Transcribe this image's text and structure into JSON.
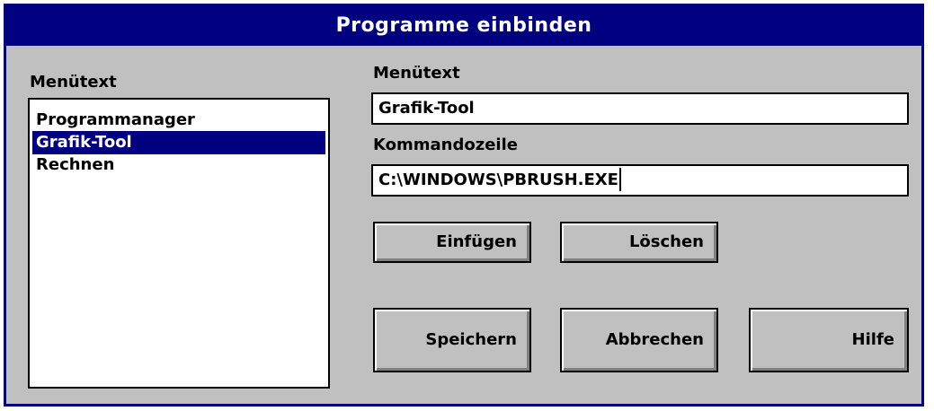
{
  "dialog": {
    "title": "Programme einbinden"
  },
  "list": {
    "label": "Menütext",
    "items": [
      {
        "label": "Programmanager",
        "selected": false
      },
      {
        "label": "Grafik-Tool",
        "selected": true
      },
      {
        "label": "Rechnen",
        "selected": false
      }
    ]
  },
  "menutext": {
    "label": "Menütext",
    "value": "Grafik-Tool"
  },
  "command": {
    "label": "Kommandozeile",
    "value": "C:\\WINDOWS\\PBRUSH.EXE"
  },
  "buttons": {
    "insert": "Einfügen",
    "delete": "Löschen",
    "save": "Speichern",
    "cancel": "Abbrechen",
    "help": "Hilfe"
  },
  "colors": {
    "titlebar": "#000080",
    "face": "#c0c0c0",
    "selection": "#000080"
  }
}
